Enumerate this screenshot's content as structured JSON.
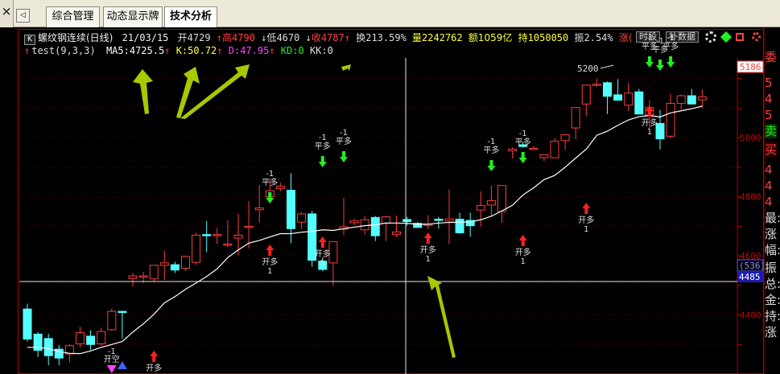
{
  "window": {
    "close_glyph": "×",
    "nav_left_glyph": "◁",
    "tabs": [
      {
        "label": "综合管理",
        "active": false
      },
      {
        "label": "动态显示牌",
        "active": false
      },
      {
        "label": "技术分析",
        "active": true
      }
    ]
  },
  "header": {
    "k_glyph": "K",
    "symbol": "螺纹钢连续(日线)",
    "date": "21/03/15",
    "open_label": "开",
    "open": "4729",
    "high_label": "高",
    "high": "4790",
    "low_label": "低",
    "low": "4670",
    "close_label": "收",
    "close": "4787",
    "turnover_label": "换",
    "turnover": "213.59%",
    "volume_label": "量",
    "volume": "2242762",
    "amount_label": "额",
    "amount": "1059亿",
    "oi_label": "持",
    "oi": "1050050",
    "amplitude_label": "振",
    "amplitude": "2.54%",
    "change_label": "涨(",
    "period_button": "时段",
    "fill_button": "补数据"
  },
  "indicator": {
    "name": "test(9,3,3)",
    "ma5_label": "MA5:",
    "ma5": "4725.5",
    "k_label": "K:",
    "k": "50.72",
    "d_label": "D:",
    "d": "47.95",
    "kd_label": "KD:",
    "kd": "0",
    "kk_label": "KK:",
    "kk": "0"
  },
  "colors": {
    "bull": "#ff3b3b",
    "bear": "#54ffff",
    "axis": "#c00000",
    "buy_arrow": "#ff2020",
    "sell_arrow": "#22ee22",
    "annotation_arrow": "#a8c800",
    "ma_line": "#ffffff"
  },
  "axis": {
    "price_labels": [
      "5000",
      "4800",
      "4600",
      "4400"
    ],
    "last_price": "5186",
    "cursor_price": "4485",
    "cursor_bracket": "(536)"
  },
  "chart_labels": {
    "high_mark": "5200",
    "sell_tag": "-1",
    "sell_text": "平多",
    "buy_text": "开多",
    "buy_tag": "1",
    "open_short": "开空",
    "close_short": "平空"
  },
  "right_panel": [
    "委",
    "5",
    "4",
    "5",
    "卖",
    "买",
    "4",
    "4",
    "4",
    "最:",
    "涨",
    "幅:",
    "振",
    "总:",
    "金:",
    "持:",
    "涨"
  ],
  "chart_data": {
    "type": "candlestick",
    "ylim": [
      4200,
      5270
    ],
    "candles": [
      [
        4420,
        4438,
        4310,
        4318
      ],
      [
        4335,
        4342,
        4258,
        4280
      ],
      [
        4320,
        4336,
        4230,
        4262
      ],
      [
        4284,
        4298,
        4230,
        4254
      ],
      [
        4268,
        4300,
        4238,
        4296
      ],
      [
        4302,
        4360,
        4290,
        4340
      ],
      [
        4328,
        4348,
        4282,
        4300
      ],
      [
        4302,
        4356,
        4296,
        4344
      ],
      [
        4350,
        4422,
        4346,
        4412
      ],
      [
        4412,
        4414,
        4320,
        4408
      ],
      [
        4523,
        4542,
        4497,
        4532
      ],
      [
        4532,
        4546,
        4508,
        4532
      ],
      [
        4522,
        4566,
        4513,
        4568
      ],
      [
        4568,
        4618,
        4519,
        4576
      ],
      [
        4570,
        4580,
        4542,
        4552
      ],
      [
        4558,
        4600,
        4548,
        4598
      ],
      [
        4578,
        4678,
        4570,
        4670
      ],
      [
        4672,
        4718,
        4612,
        4670
      ],
      [
        4672,
        4694,
        4640,
        4672
      ],
      [
        4640,
        4720,
        4630,
        4640
      ],
      [
        4660,
        4742,
        4602,
        4670
      ],
      [
        4700,
        4785,
        4625,
        4700
      ],
      [
        4756,
        4840,
        4712,
        4762
      ],
      [
        4800,
        4862,
        4782,
        4820
      ],
      [
        4828,
        4847,
        4819,
        4836
      ],
      [
        4822,
        4880,
        4643,
        4692
      ],
      [
        4714,
        4748,
        4690,
        4742
      ],
      [
        4742,
        4752,
        4563,
        4585
      ],
      [
        4582,
        4594,
        4548,
        4554
      ],
      [
        4576,
        4648,
        4500,
        4648
      ],
      [
        4690,
        4796,
        4670,
        4698
      ],
      [
        4712,
        4726,
        4704,
        4718
      ],
      [
        4688,
        4734,
        4672,
        4722
      ],
      [
        4730,
        4735,
        4650,
        4668
      ],
      [
        4710,
        4735,
        4650,
        4732
      ],
      [
        4673,
        4736,
        4664,
        4681
      ],
      [
        4723,
        4732,
        4702,
        4716
      ],
      [
        4710,
        4714,
        4700,
        4696
      ],
      [
        4705,
        4738,
        4690,
        4707
      ],
      [
        4724,
        4732,
        4692,
        4720
      ],
      [
        4718,
        4825,
        4640,
        4725
      ],
      [
        4724,
        4746,
        4674,
        4678
      ],
      [
        4720,
        4746,
        4665,
        4702
      ],
      [
        4755,
        4818,
        4700,
        4770
      ],
      [
        4772,
        4838,
        4735,
        4787
      ],
      [
        4750,
        4838,
        4712,
        4838
      ],
      [
        4955,
        4968,
        4930,
        4961
      ],
      [
        4976,
        4985,
        4966,
        4970
      ],
      [
        4964,
        4972,
        4958,
        4964
      ],
      [
        4932,
        4942,
        4921,
        4942
      ],
      [
        4932,
        4998,
        4932,
        4988
      ],
      [
        4990,
        5000,
        4958,
        5010
      ],
      [
        5033,
        5102,
        4995,
        5102
      ],
      [
        5114,
        5170,
        5073,
        5178
      ],
      [
        5181,
        5200,
        5173,
        5181
      ],
      [
        5186,
        5190,
        5080,
        5140
      ],
      [
        5145,
        5198,
        5125,
        5127
      ],
      [
        5110,
        5186,
        5090,
        5151
      ],
      [
        5155,
        5165,
        5080,
        5080
      ],
      [
        5077,
        5126,
        5030,
        5102
      ],
      [
        5048,
        5094,
        4960,
        4996
      ],
      [
        5005,
        5148,
        4998,
        5116
      ],
      [
        5116,
        5146,
        5095,
        5142
      ],
      [
        5142,
        5165,
        5120,
        5114
      ],
      [
        5128,
        5163,
        5100,
        5138
      ]
    ],
    "ma_values": [
      4290,
      4290,
      4286,
      4276,
      4270,
      4269,
      4278,
      4290,
      4300,
      4310,
      4342,
      4370,
      4402,
      4441,
      4462,
      4487,
      4508,
      4530,
      4556,
      4594,
      4620,
      4643,
      4652,
      4664,
      4675,
      4675,
      4680,
      4683,
      4688,
      4686,
      4692,
      4697,
      4702,
      4705,
      4711,
      4711,
      4710,
      4707,
      4707,
      4711,
      4713,
      4714,
      4715,
      4722,
      4734,
      4752,
      4771,
      4806,
      4830,
      4858,
      4872,
      4900,
      4931,
      4961,
      5008,
      5022,
      5042,
      5060,
      5071,
      5075,
      5070,
      5084,
      5091,
      5098,
      5107
    ]
  }
}
